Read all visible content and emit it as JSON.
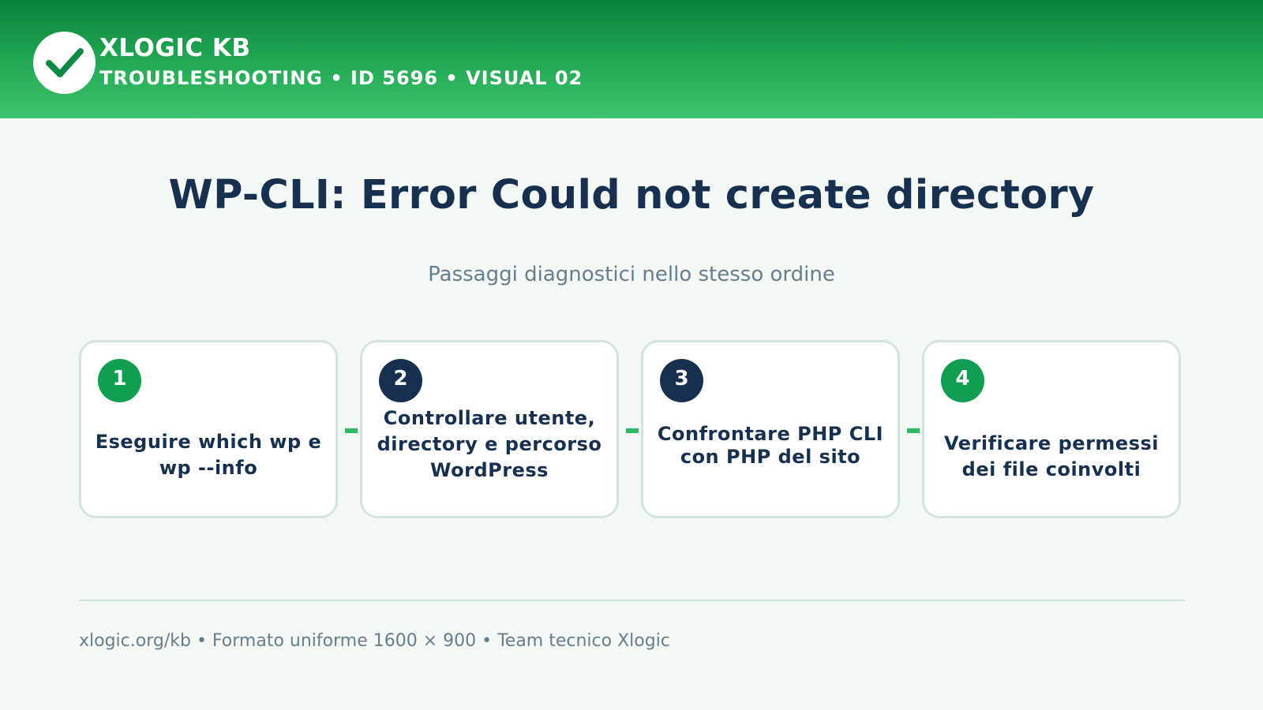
{
  "header": {
    "brand": "XLOGIC KB",
    "subtitle": "TROUBLESHOOTING • ID 5696 • VISUAL 02",
    "logo_icon": "check-icon",
    "colors": {
      "gradient_top": "#05843c",
      "gradient_bottom": "#3cc46c"
    }
  },
  "main": {
    "title": "WP-CLI: Error Could not create directory",
    "subtitle": "Passaggi diagnostici nello stesso ordine"
  },
  "steps": [
    {
      "number": "1",
      "text": "Eseguire which wp e wp --info",
      "badge_color": "#0f9e52"
    },
    {
      "number": "2",
      "text": "Controllare utente, directory e percorso WordPress",
      "badge_color": "#17304f"
    },
    {
      "number": "3",
      "text": "Confrontare PHP CLI con PHP del sito",
      "badge_color": "#17304f"
    },
    {
      "number": "4",
      "text": "Verificare permessi dei file coinvolti",
      "badge_color": "#0f9e52"
    }
  ],
  "footer": {
    "text": "xlogic.org/kb • Formato uniforme 1600 × 900 • Team tecnico Xlogic"
  }
}
